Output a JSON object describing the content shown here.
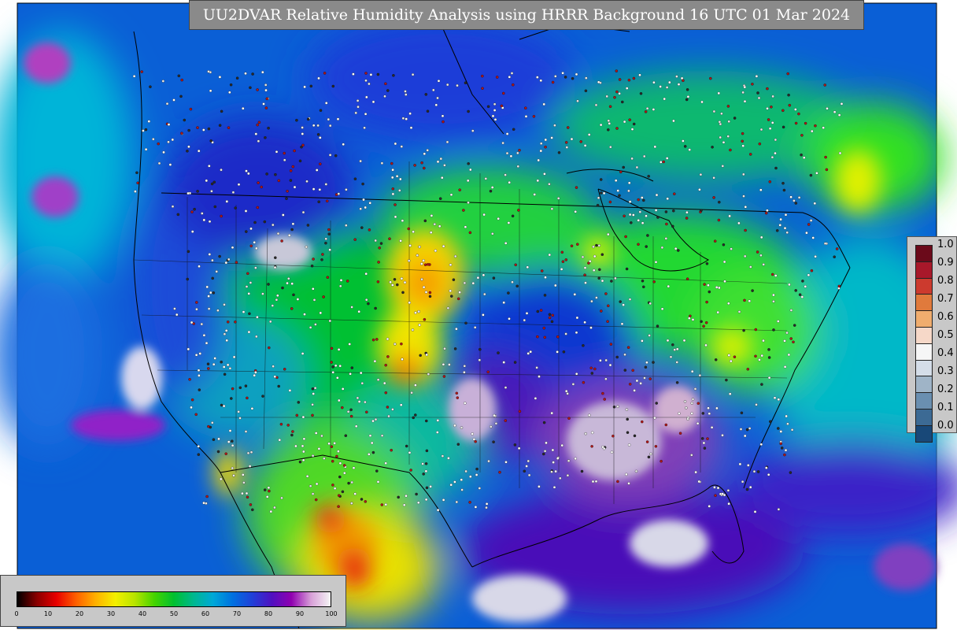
{
  "title": "UU2DVAR Relative Humidity Analysis using HRRR Background 16 UTC 01 Mar 2024",
  "colors": {
    "ocean_humid": "#0a5fd6",
    "land_moderate": "#00c000",
    "dry_yellow": "#f5e000",
    "dry_orange": "#f59a00",
    "very_dry_red": "#e01010",
    "saturated_purple": "#7a00c0",
    "saturated_white": "#e8e8f4",
    "obs_red": "#b01818"
  },
  "error_legend": {
    "labels": [
      "1.0",
      "0.9",
      "0.8",
      "0.7",
      "0.6",
      "0.5",
      "0.4",
      "0.3",
      "0.2",
      "0.1",
      "0.0"
    ],
    "swatches": [
      "#6b0a1a",
      "#a8182a",
      "#cc3a2e",
      "#e07a3c",
      "#f0ad6e",
      "#f6d8c8",
      "#f6f6f6",
      "#d4dde8",
      "#9fb4c7",
      "#6a8fb0",
      "#3c6a94",
      "#184878"
    ]
  },
  "rh_legend": {
    "ticks": [
      "0",
      "10",
      "20",
      "30",
      "40",
      "50",
      "60",
      "70",
      "80",
      "90",
      "100"
    ],
    "stops": [
      "#000000",
      "#8a0000",
      "#e80000",
      "#ff6000",
      "#ffb000",
      "#f4f000",
      "#b8e400",
      "#44d400",
      "#00c030",
      "#00b890",
      "#00a8d8",
      "#0070e0",
      "#2040d8",
      "#5010c0",
      "#9000b0",
      "#d8a0d8",
      "#f4f4f4"
    ]
  }
}
